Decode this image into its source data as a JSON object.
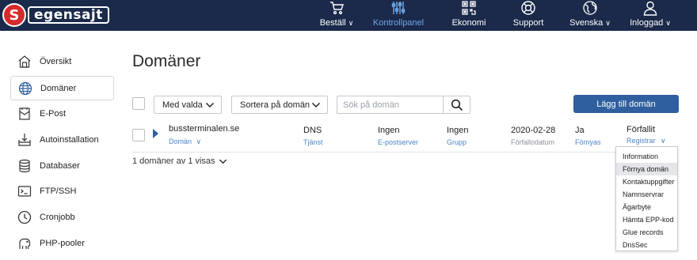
{
  "brand": {
    "logo_text": "egensajt"
  },
  "nav": [
    {
      "label": "Beställ",
      "icon": "cart-icon",
      "has_dropdown": true
    },
    {
      "label": "Kontrollpanel",
      "icon": "sliders-icon",
      "active": true
    },
    {
      "label": "Ekonomi",
      "icon": "qr-icon"
    },
    {
      "label": "Support",
      "icon": "lifebuoy-icon"
    },
    {
      "label": "Svenska",
      "icon": "globe-icon",
      "has_dropdown": true
    },
    {
      "label": "Inloggad",
      "icon": "user-icon",
      "has_dropdown": true
    }
  ],
  "sidebar": {
    "items": [
      {
        "label": "Översikt",
        "icon": "house-icon"
      },
      {
        "label": "Domäner",
        "icon": "globe-icon",
        "active": true
      },
      {
        "label": "E-Post",
        "icon": "envelope-icon"
      },
      {
        "label": "Autoinstallation",
        "icon": "install-icon"
      },
      {
        "label": "Databaser",
        "icon": "database-icon"
      },
      {
        "label": "FTP/SSH",
        "icon": "terminal-icon"
      },
      {
        "label": "Cronjobb",
        "icon": "clock-icon"
      },
      {
        "label": "PHP-pooler",
        "icon": "elephant-icon"
      }
    ]
  },
  "main": {
    "title": "Domäner",
    "bulk_select_label": "Med valda",
    "sort_label": "Sortera på domän",
    "search_placeholder": "Sök på domän",
    "add_button": "Lägg till domän",
    "count_text": "1 domäner av 1 visas"
  },
  "domain_row": {
    "name": "bussterminalen.se",
    "name_sub": "Domän",
    "dns": "DNS",
    "dns_sub": "Tjänst",
    "mail": "Ingen",
    "mail_sub": "E-postserver",
    "group": "Ingen",
    "group_sub": "Grupp",
    "expiry": "2020-02-28",
    "expiry_sub": "Förfallodatum",
    "renew": "Ja",
    "renew_sub": "Förnyas",
    "status": "Förfallit",
    "status_sub": "Registrar"
  },
  "registrar_menu": {
    "items": [
      "Information",
      "Förnya domän",
      "Kontaktuppgifter",
      "Namnservrar",
      "Ägarbyte",
      "Hämta EPP-kod",
      "Glue records",
      "DnsSec"
    ],
    "highlighted": "Förnya domän"
  },
  "colors": {
    "topbar": "#1b2a4a",
    "active_nav": "#6fa8e8",
    "primary_button": "#2f5f9e",
    "link": "#4a86c7",
    "logo_red": "#d62b2b"
  }
}
